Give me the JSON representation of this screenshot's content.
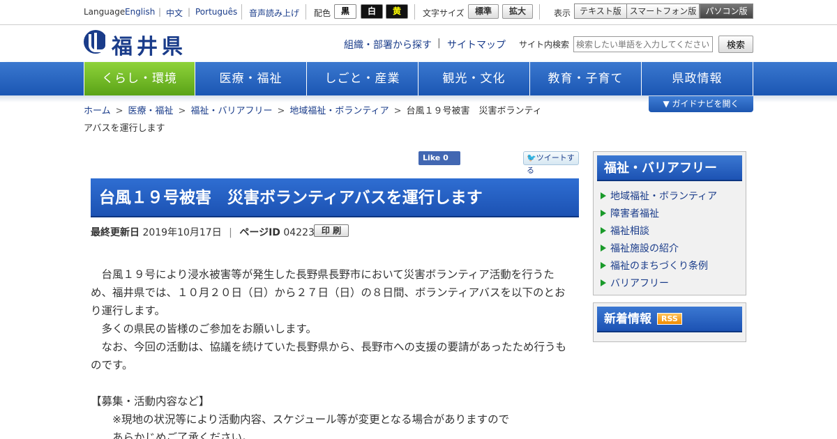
{
  "util": {
    "language_label": "Language",
    "lang_en": "English",
    "lang_zh": "中文",
    "lang_pt": "Português",
    "voice": "音声読み上げ",
    "color_label": "配色",
    "color_black": "黒",
    "color_white": "白",
    "color_yellow": "黄",
    "fontsize_label": "文字サイズ",
    "font_standard": "標準",
    "font_large": "拡大",
    "view_label": "表示",
    "view_text": "テキスト版",
    "view_smartphone": "スマートフォン版",
    "view_pc": "パソコン版"
  },
  "header": {
    "logo_text": "福井県",
    "org_search": "組織・部署から探す",
    "sitemap": "サイトマップ",
    "search_label": "サイト内検索",
    "search_placeholder": "検索したい単語を入力してください",
    "search_button": "検索"
  },
  "nav": [
    "くらし・環境",
    "医療・福祉",
    "しごと・産業",
    "観光・文化",
    "教育・子育て",
    "県政情報"
  ],
  "breadcrumb": {
    "items": [
      "ホーム",
      "医療・福祉",
      "福祉・バリアフリー",
      "地域福祉・ボランティア"
    ],
    "current_line1": "台風１９号被害　災害ボランティ",
    "current_line2": "アバスを運行します",
    "guide_button": "▼ ガイドナビを開く"
  },
  "social": {
    "fb_label": "Like 0",
    "tw_label": "ツイートする"
  },
  "page": {
    "title": "台風１９号被害　災害ボランティアバスを運行します",
    "updated_label": "最終更新日",
    "updated_value": "2019年10月17日",
    "pageid_label": "ページID",
    "pageid_value": "042230",
    "print_button": "印 刷",
    "paragraphs": [
      "　台風１９号により浸水被害等が発生した長野県長野市において災害ボランティア活動を行うため、福井県では、１０月２０日（日）から２７日（日）の８日間、ボランティアバスを以下のとおり運行します。",
      "　多くの県民の皆様のご参加をお願いします。",
      "　なお、今回の活動は、協議を続けていた長野県から、長野市への支援の要請があったため行うものです。",
      "",
      "【募集・活動内容など】",
      "　　※現地の状況等により活動内容、スケジュール等が変更となる場合がありますので",
      "　　あらかじめご了承ください。"
    ]
  },
  "sidebar": {
    "title": "福祉・バリアフリー",
    "items": [
      "地域福祉・ボランティア",
      "障害者福祉",
      "福祉相談",
      "福祉施設の紹介",
      "福祉のまちづくり条例",
      "バリアフリー"
    ],
    "news_title": "新着情報",
    "rss": "RSS"
  },
  "colors": {
    "accent_blue": "#1c52b3",
    "nav_active_green": "#5aa317",
    "link_blue": "#1a3c8a"
  }
}
